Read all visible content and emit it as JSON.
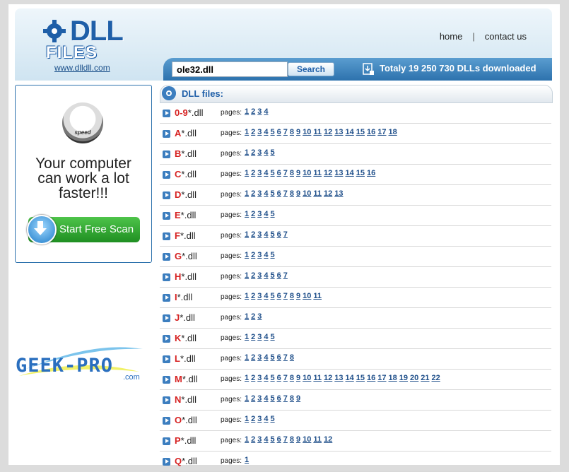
{
  "header": {
    "logo_top": "DLL",
    "logo_bottom": "FILES",
    "site_link": "www.dlldll.com",
    "nav_home": "home",
    "nav_separator": "|",
    "nav_contact": "contact us",
    "search_value": "ole32.dll",
    "search_button": "Search",
    "downloads_text": "Totaly 19 250 730 DLLs downloaded"
  },
  "ad": {
    "gauge_label": "speed",
    "line1": "Your computer",
    "line2": "can work a lot",
    "line3": "faster!!!",
    "scan_button": "Start Free Scan",
    "geek_text": "GEEK-PRO",
    "geek_com": ".com"
  },
  "list": {
    "title": "DLL files:",
    "pages_label": "pages:",
    "rows": [
      {
        "letter": "0-9",
        "suffix": "*.dll",
        "pages": 4
      },
      {
        "letter": "A",
        "suffix": "*.dll",
        "pages": 18
      },
      {
        "letter": "B",
        "suffix": "*.dll",
        "pages": 5
      },
      {
        "letter": "C",
        "suffix": "*.dll",
        "pages": 16
      },
      {
        "letter": "D",
        "suffix": "*.dll",
        "pages": 13
      },
      {
        "letter": "E",
        "suffix": "*.dll",
        "pages": 5
      },
      {
        "letter": "F",
        "suffix": "*.dll",
        "pages": 7
      },
      {
        "letter": "G",
        "suffix": "*.dll",
        "pages": 5
      },
      {
        "letter": "H",
        "suffix": "*.dll",
        "pages": 7
      },
      {
        "letter": "I",
        "suffix": "*.dll",
        "pages": 11
      },
      {
        "letter": "J",
        "suffix": "*.dll",
        "pages": 3
      },
      {
        "letter": "K",
        "suffix": "*.dll",
        "pages": 5
      },
      {
        "letter": "L",
        "suffix": "*.dll",
        "pages": 8
      },
      {
        "letter": "M",
        "suffix": "*.dll",
        "pages": 22
      },
      {
        "letter": "N",
        "suffix": "*.dll",
        "pages": 9
      },
      {
        "letter": "O",
        "suffix": "*.dll",
        "pages": 5
      },
      {
        "letter": "P",
        "suffix": "*.dll",
        "pages": 12
      },
      {
        "letter": "Q",
        "suffix": "*.dll",
        "pages": 1
      }
    ]
  },
  "colors": {
    "accent": "#1f5fa8",
    "letter": "#d62222",
    "link": "#1f4f8a"
  }
}
